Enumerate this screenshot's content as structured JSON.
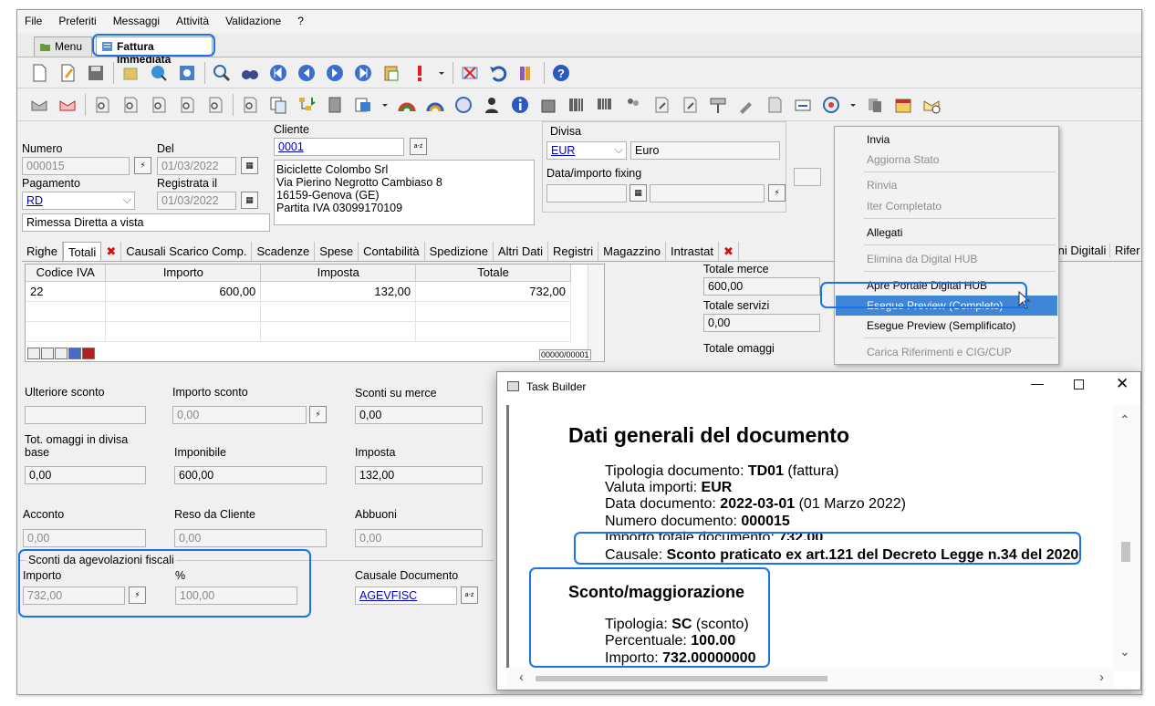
{
  "menubar": [
    "File",
    "Preferiti",
    "Messaggi",
    "Attività",
    "Validazione",
    "?"
  ],
  "doc_tabs": {
    "menu": "Menu",
    "active": "Fattura Immediata"
  },
  "header": {
    "numero_label": "Numero",
    "numero_value": "000015",
    "del_label": "Del",
    "del_value": "01/03/2022",
    "pagamento_label": "Pagamento",
    "pagamento_value": "RD",
    "registrata_label": "Registrata il",
    "registrata_value": "01/03/2022",
    "pagamento_desc": "Rimessa Diretta a vista",
    "cliente_label": "Cliente",
    "cliente_code": "0001",
    "cliente_address": [
      "Biciclette Colombo Srl",
      "Via Pierino Negrotto Cambiaso 8",
      "16159-Genova (GE)",
      "Partita IVA 03099170109"
    ],
    "divisa_label": "Divisa",
    "divisa_code": "EUR",
    "divisa_desc": "Euro",
    "fixing_label": "Data/importo fixing"
  },
  "page_tabs": [
    "Righe",
    "Totali",
    "Causali Scarico Comp.",
    "Scadenze",
    "Spese",
    "Contabilità",
    "Spedizione",
    "Altri Dati",
    "Registri",
    "Magazzino",
    "Intrastat",
    "zioni Digitali",
    "Rifer"
  ],
  "iva_grid": {
    "columns": [
      "Codice IVA",
      "Importo",
      "Imposta",
      "Totale"
    ],
    "rows": [
      [
        "22",
        "600,00",
        "132,00",
        "732,00"
      ]
    ],
    "counter": "00000/00001"
  },
  "totals_right": {
    "merce_label": "Totale merce",
    "merce_value": "600,00",
    "servizi_label": "Totale servizi",
    "servizi_value": "0,00",
    "omaggi_label": "Totale omaggi"
  },
  "totals": {
    "ulteriore_sconto_label": "Ulteriore sconto",
    "importo_sconto_label": "Importo sconto",
    "importo_sconto_value": "0,00",
    "sconti_merce_label": "Sconti su merce",
    "sconti_merce_value": "0,00",
    "omaggi_divisa_label_1": "Tot. omaggi in divisa",
    "omaggi_divisa_label_2": "base",
    "omaggi_divisa_value": "0,00",
    "imponibile_label": "Imponibile",
    "imponibile_value": "600,00",
    "imposta_label": "Imposta",
    "imposta_value": "132,00",
    "acconto_label": "Acconto",
    "acconto_value": "0,00",
    "reso_label": "Reso da Cliente",
    "reso_value": "0,00",
    "abbuoni_label": "Abbuoni",
    "abbuoni_value": "0,00",
    "agev_title": "Sconti da agevolazioni fiscali",
    "agev_importo_label": "Importo",
    "agev_importo_value": "732,00",
    "agev_perc_label": "%",
    "agev_perc_value": "100,00",
    "causale_label": "Causale Documento",
    "causale_value": "AGEVFISC"
  },
  "dropdown": {
    "items": [
      {
        "label": "Invia",
        "state": "enabled"
      },
      {
        "label": "Aggiorna Stato",
        "state": "disabled"
      },
      {
        "label": "Rinvia",
        "state": "disabled"
      },
      {
        "label": "Iter Completato",
        "state": "disabled"
      },
      {
        "label": "Allegati",
        "state": "enabled"
      },
      {
        "label": "Elimina da Digital HUB",
        "state": "disabled"
      },
      {
        "label": "Apre Portale Digital HUB",
        "state": "enabled"
      },
      {
        "label": "Esegue Preview (Completo)",
        "state": "selected"
      },
      {
        "label": "Esegue Preview (Semplificato)",
        "state": "enabled"
      },
      {
        "label": "Carica Riferimenti e CIG/CUP",
        "state": "disabled"
      }
    ]
  },
  "task_builder": {
    "title": "Task Builder",
    "section1_title": "Dati generali del documento",
    "tipologia_label": "Tipologia documento: ",
    "tipologia_value": "TD01",
    "tipologia_suffix": " (fattura)",
    "valuta_label": "Valuta importi: ",
    "valuta_value": "EUR",
    "data_label": "Data documento: ",
    "data_value": "2022-03-01",
    "data_suffix": " (01 Marzo 2022)",
    "numero_label": "Numero documento: ",
    "numero_value": "000015",
    "importo_label": "Importo totale documento: ",
    "importo_value": "732,00",
    "causale_label": "Causale: ",
    "causale_value": "Sconto praticato ex art.121 del Decreto Legge n.34 del 2020",
    "section2_title": "Sconto/maggiorazione",
    "sc_tipologia_label": "Tipologia: ",
    "sc_tipologia_value": "SC",
    "sc_tipologia_suffix": " (sconto)",
    "sc_perc_label": "Percentuale: ",
    "sc_perc_value": "100.00",
    "sc_importo_label": "Importo: ",
    "sc_importo_value": "732.00000000"
  },
  "colors": {
    "highlight": "#1a73e8",
    "menu_selected": "#3f86d6",
    "link": "#0000cc"
  }
}
